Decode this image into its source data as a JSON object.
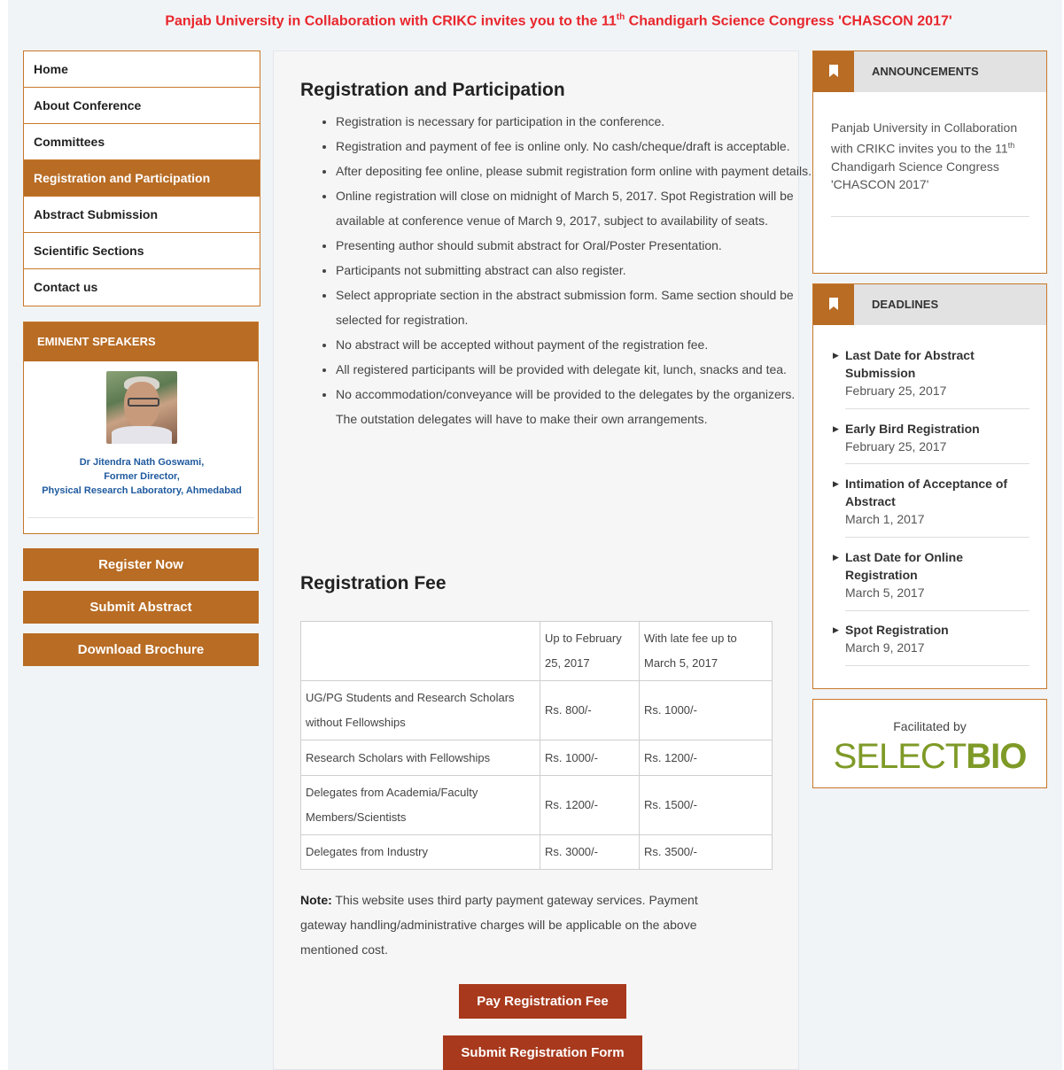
{
  "banner": {
    "prefix": "Panjab University in Collaboration with CRIKC invites you to the 11",
    "sup": "th",
    "suffix": " Chandigarh Science Congress 'CHASCON 2017'"
  },
  "nav": {
    "items": [
      "Home",
      "About Conference",
      "Committees",
      "Registration and Participation",
      "Abstract Submission",
      "Scientific Sections",
      "Contact us"
    ],
    "active_index": 3
  },
  "speakers": {
    "heading": "EMINENT SPEAKERS",
    "name": "Dr Jitendra Nath Goswami,",
    "role": "Former Director,",
    "org": "Physical Research Laboratory, Ahmedabad"
  },
  "side_buttons": {
    "register": "Register Now",
    "submit_abstract": "Submit Abstract",
    "brochure": "Download Brochure"
  },
  "main": {
    "title": "Registration and Participation",
    "bullets": [
      "Registration is necessary for participation in the conference.",
      "Registration and payment of fee is online only. No cash/cheque/draft is acceptable.",
      "After depositing fee online, please submit registration form online with payment details.",
      "Online registration will close on midnight of March 5, 2017. Spot Registration will be available at conference venue of March 9, 2017, subject to availability of seats.",
      "Presenting author should submit abstract for Oral/Poster Presentation.",
      "Participants not submitting abstract can also register.",
      "Select appropriate section in the abstract submission form. Same section should be selected for registration.",
      "No abstract will be accepted without payment of the registration fee.",
      "All registered participants will be provided with delegate kit, lunch, snacks and tea.",
      "No accommodation/conveyance will be provided to the delegates by the organizers. The outstation delegates will have to make their own arrangements."
    ],
    "fee_title": "Registration Fee",
    "fee_table": {
      "headers": [
        "",
        "Up to February 25, 2017",
        "With late fee up to March 5, 2017"
      ],
      "rows": [
        [
          "UG/PG Students and Research Scholars without Fellowships",
          "Rs. 800/-",
          "Rs. 1000/-"
        ],
        [
          "Research Scholars with Fellowships",
          "Rs. 1000/-",
          "Rs. 1200/-"
        ],
        [
          "Delegates from Academia/Faculty Members/Scientists",
          "Rs. 1200/-",
          "Rs. 1500/-"
        ],
        [
          "Delegates from Industry",
          "Rs. 3000/-",
          "Rs. 3500/-"
        ]
      ]
    },
    "note_label": "Note:",
    "note_text": " This website uses third party payment gateway services. Payment gateway handling/administrative charges will be applicable on the above mentioned cost.",
    "pay_button": "Pay Registration Fee",
    "submit_form_button": "Submit Registration Form"
  },
  "announcements": {
    "heading": "ANNOUNCEMENTS",
    "text_prefix": "Panjab University in Collaboration with CRIKC invites you to the 11",
    "text_sup": "th",
    "text_suffix": " Chandigarh Science Congress 'CHASCON 2017'"
  },
  "deadlines": {
    "heading": "DEADLINES",
    "items": [
      {
        "title": "Last Date for Abstract Submission",
        "date": "February 25, 2017"
      },
      {
        "title": "Early Bird Registration",
        "date": "February 25, 2017"
      },
      {
        "title": "Intimation of Acceptance of Abstract",
        "date": "March 1, 2017"
      },
      {
        "title": "Last Date for Online Registration",
        "date": "March 5, 2017"
      },
      {
        "title": "Spot Registration",
        "date": "March 9, 2017"
      }
    ]
  },
  "facilitator": {
    "label": "Facilitated by",
    "logo_light": "SELECT",
    "logo_bold": "BIO"
  },
  "colors": {
    "accent": "#b86c24",
    "button_red": "#a8391c",
    "banner_red": "#e8262c",
    "link_blue": "#1f5a9e",
    "logo_green": "#7e9a27"
  }
}
